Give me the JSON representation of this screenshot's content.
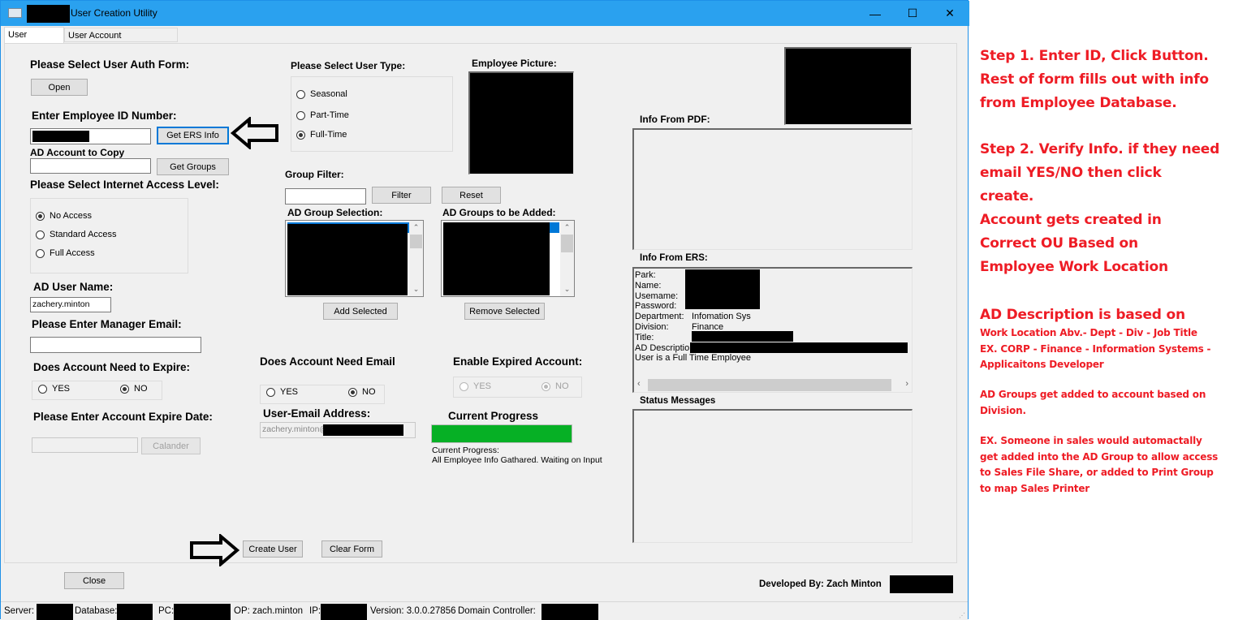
{
  "window": {
    "title": "User Creation Utility",
    "controls": {
      "minimize": "—",
      "maximize": "☐",
      "close": "✕"
    }
  },
  "tabs": [
    {
      "label": "User Creation",
      "active": true
    },
    {
      "label": "User Account Management",
      "active": false
    }
  ],
  "auth_form": {
    "label": "Please Select User Auth Form:",
    "open_button": "Open"
  },
  "employee_id": {
    "label": "Enter Employee ID Number:",
    "value": "",
    "get_ers_button": "Get ERS Info"
  },
  "ad_copy": {
    "label": "AD Account to Copy",
    "value": "",
    "get_groups_button": "Get Groups"
  },
  "internet_access": {
    "label": "Please Select Internet Access Level:",
    "options": [
      "No Access",
      "Standard Access",
      "Full Access"
    ],
    "selected": "No Access"
  },
  "ad_user_name": {
    "label": "AD User Name:",
    "value": "zachery.minton"
  },
  "manager_email": {
    "label": "Please Enter Manager Email:",
    "value": ""
  },
  "expire": {
    "label": "Does Account Need to Expire:",
    "options": [
      "YES",
      "NO"
    ],
    "selected": "NO"
  },
  "expire_date": {
    "label": "Please Enter Account Expire Date:",
    "value": "",
    "calendar_button": "Calander"
  },
  "user_type": {
    "label": "Please Select User Type:",
    "options": [
      "Seasonal",
      "Part-Time",
      "Full-Time"
    ],
    "selected": "Full-Time"
  },
  "employee_picture": {
    "label": "Employee Picture:"
  },
  "group_filter": {
    "label": "Group Filter:",
    "value": "",
    "filter_button": "Filter",
    "reset_button": "Reset"
  },
  "ad_group_selection": {
    "label": "AD Group Selection:",
    "add_button": "Add Selected"
  },
  "ad_groups_to_add": {
    "label": "AD Groups to be Added:",
    "remove_button": "Remove Selected"
  },
  "email": {
    "label": "Does Account Need Email",
    "options": [
      "YES",
      "NO"
    ],
    "selected": "NO",
    "address_label": "User-Email Address:",
    "address_value": "zachery.minton@"
  },
  "expired_account": {
    "label": "Enable Expired Account:",
    "options": [
      "YES",
      "NO"
    ],
    "selected": "NO",
    "disabled": true
  },
  "progress": {
    "label": "Current Progress",
    "value_percent": 100,
    "color": "#06b025",
    "status_title": "Current Progress:",
    "status_text": "All Employee Info Gathared. Waiting on Input"
  },
  "info_from_pdf": {
    "label": "Info From PDF:",
    "text": ""
  },
  "info_from_ers": {
    "label": "Info From ERS:",
    "rows": [
      {
        "key": "Park:",
        "value": ""
      },
      {
        "key": "Name:",
        "value": ""
      },
      {
        "key": "Usemame:",
        "value": ""
      },
      {
        "key": "Password:",
        "value": ""
      },
      {
        "key": "Department:",
        "value": "Infomation Sys"
      },
      {
        "key": "Division:",
        "value": "Finance"
      },
      {
        "key": "Title:",
        "value": ""
      },
      {
        "key": "AD Description",
        "value": ""
      }
    ],
    "footer": "User is a Full Time Employee"
  },
  "status_messages": {
    "label": "Status Messages",
    "text": ""
  },
  "actions": {
    "create_user": "Create User",
    "clear_form": "Clear Form",
    "close": "Close"
  },
  "developer": {
    "text": "Developed By: Zach Minton"
  },
  "status_bar": {
    "server_label": "Server:",
    "database_label": "Database:",
    "pc_label": "PC:",
    "op": "OP: zach.minton",
    "ip_label": "IP:",
    "version": "Version: 3.0.0.27856",
    "dc_label": "Domain Controller:"
  },
  "annotations": {
    "step1": [
      "Step 1. Enter ID, Click Button.",
      "Rest of form fills out with info",
      "from Employee Database."
    ],
    "step2": [
      "Step 2. Verify Info. if they need",
      "email YES/NO then click",
      "create.",
      "Account gets created in",
      "Correct OU Based on",
      "Employee Work Location"
    ],
    "ad_desc_title": "AD Description is based on",
    "ad_desc": [
      "Work Location Abv.- Dept - Div - Job Title",
      "EX. CORP - Finance - Information Systems -",
      "Applicaitons Developer"
    ],
    "groups": [
      "AD Groups get added to account based on",
      "Division."
    ],
    "example": [
      "EX. Someone in sales would automactally",
      "get added into the AD Group to allow access",
      "to Sales File Share, or added to Print Group",
      "to map Sales Printer"
    ],
    "color": "#ee1c25"
  }
}
